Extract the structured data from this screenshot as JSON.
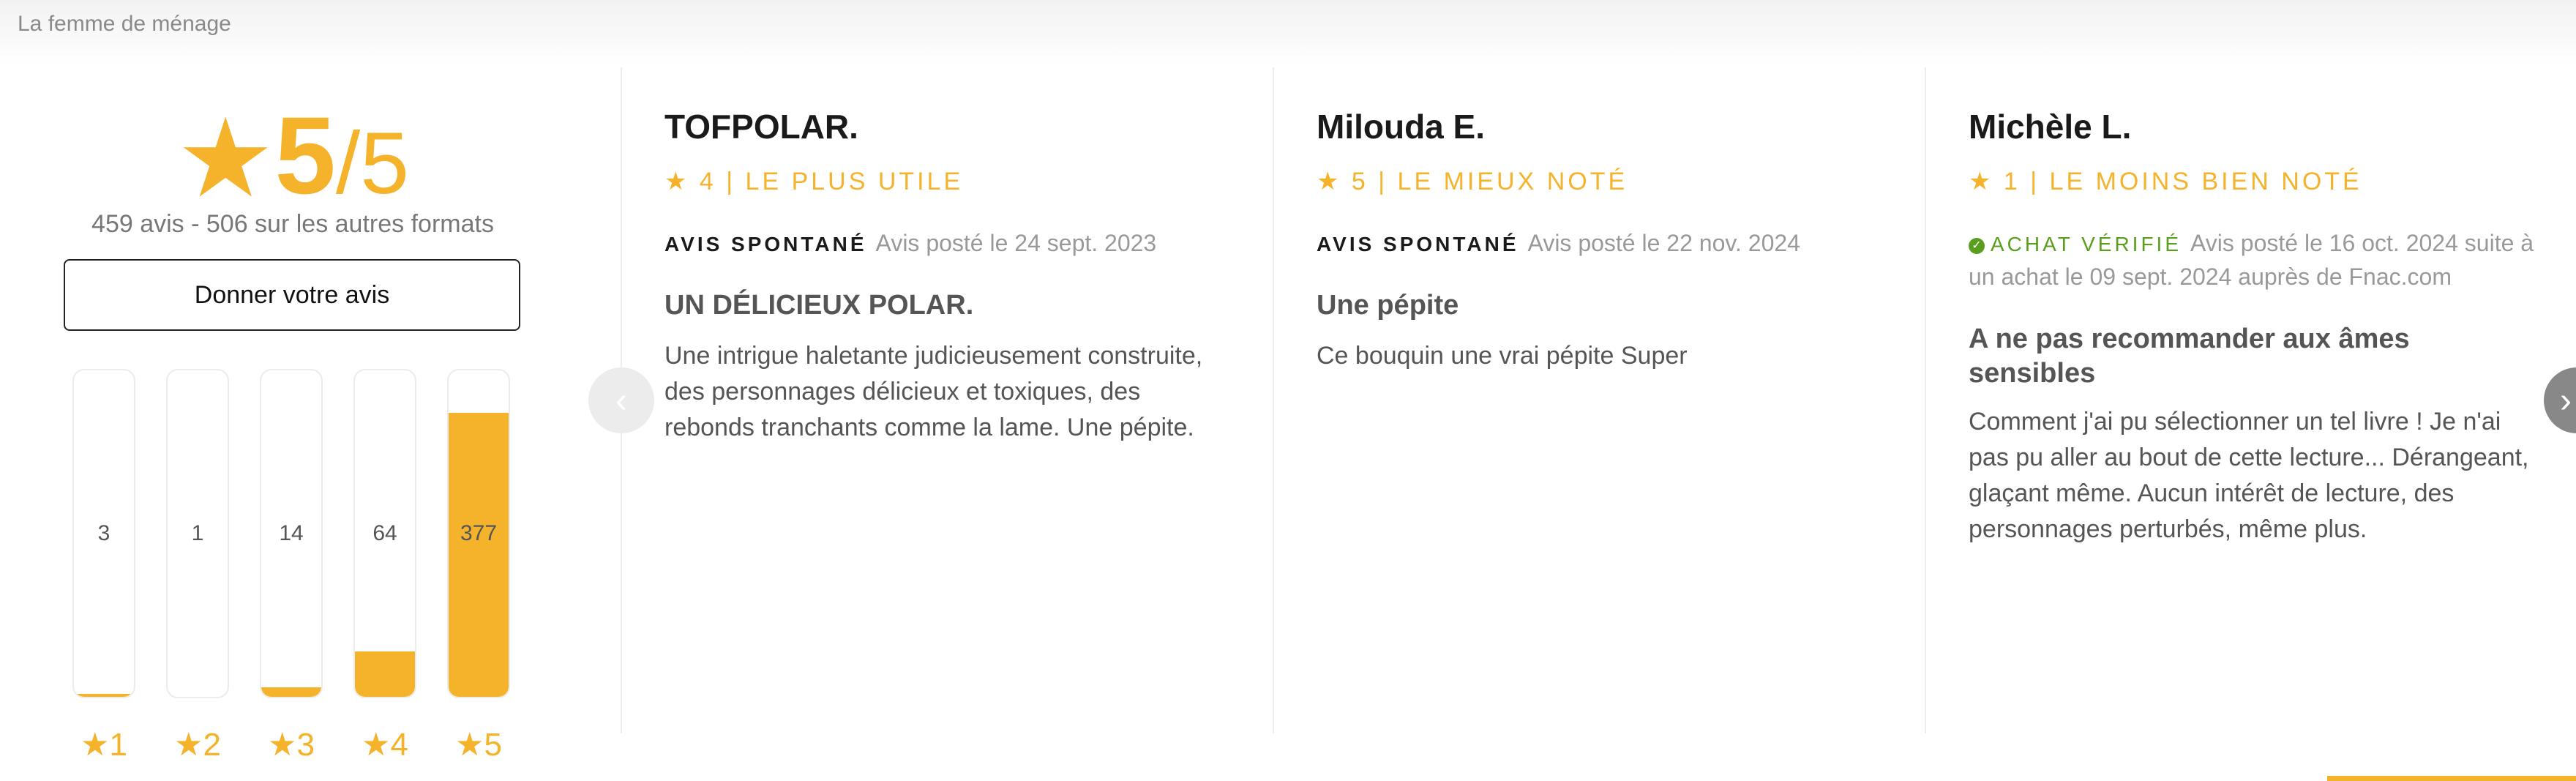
{
  "breadcrumb": "La femme de ménage",
  "summary": {
    "star_glyph": "★",
    "score": "5",
    "slash": "/",
    "max": "5",
    "count_line": "459 avis - 506 sur les autres formats",
    "give_review_label": "Donner votre avis",
    "distribution": [
      {
        "label": "★1",
        "count": "3",
        "fraction": 0.008
      },
      {
        "label": "★2",
        "count": "1",
        "fraction": 0.0
      },
      {
        "label": "★3",
        "count": "14",
        "fraction": 0.03
      },
      {
        "label": "★4",
        "count": "64",
        "fraction": 0.14
      },
      {
        "label": "★5",
        "count": "377",
        "fraction": 0.87
      }
    ]
  },
  "reviews": [
    {
      "author": "TOFPOLAR.",
      "rating_line": "★ 4  |  LE PLUS UTILE",
      "kind": "AVIS SPONTANÉ",
      "posted": "Avis posté le 24 sept. 2023",
      "title": "UN DÉLICIEUX POLAR.",
      "body": "Une intrigue haletante judicieusement construite, des personnages délicieux et toxiques, des rebonds tranchants comme la lame. Une pépite."
    },
    {
      "author": "Milouda E.",
      "rating_line": "★ 5  |  LE MIEUX NOTÉ",
      "kind": "AVIS SPONTANÉ",
      "posted": "Avis posté le 22 nov. 2024",
      "title": "Une pépite",
      "body": "Ce bouquin une vrai pépite Super"
    },
    {
      "author": "Michèle L.",
      "rating_line": "★ 1  |  LE MOINS BIEN NOTÉ",
      "kind": "ACHAT VÉRIFIÉ",
      "posted": "Avis posté le 16 oct. 2024 suite à un achat le 09 sept. 2024 auprès de Fnac.com",
      "title": "A ne pas recommander aux âmes sensibles",
      "body": "Comment j'ai pu sélectionner un tel livre ! Je n'ai pas pu aller au bout de cette lecture... Dérangeant, glaçant même. Aucun intérêt de lecture, des personnages perturbés, même plus."
    }
  ],
  "nav": {
    "prev_glyph": "‹",
    "next_glyph": "›"
  },
  "colors": {
    "accent": "#f5b32b",
    "verified": "#5a9e1e"
  }
}
